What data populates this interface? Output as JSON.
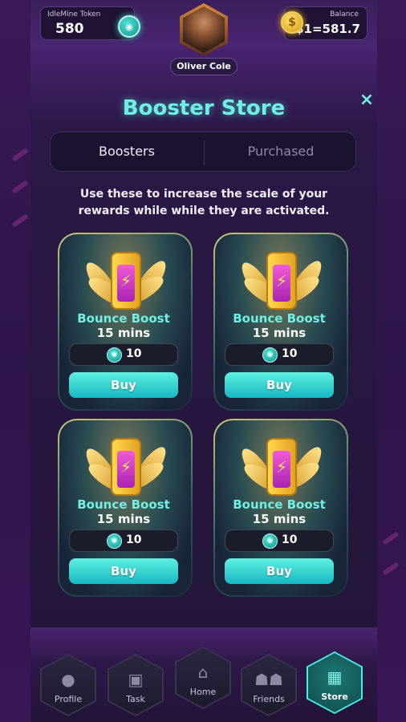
{
  "header": {
    "token_label": "IdleMine Token",
    "token_value": "580",
    "balance_label": "Balance",
    "balance_value": "$1=581.7",
    "balance_coin_symbol": "$",
    "user_name": "Oliver Cole"
  },
  "store": {
    "title": "Booster Store",
    "close_icon": "×",
    "tabs": [
      {
        "label": "Boosters",
        "active": true
      },
      {
        "label": "Purchased",
        "active": false
      }
    ],
    "description": "Use these to increase the scale of your rewards while while they are activated.",
    "cards": [
      {
        "name": "Bounce Boost",
        "duration": "15 mins",
        "price": "10",
        "buy_label": "Buy"
      },
      {
        "name": "Bounce Boost",
        "duration": "15 mins",
        "price": "10",
        "buy_label": "Buy"
      },
      {
        "name": "Bounce Boost",
        "duration": "15 mins",
        "price": "10",
        "buy_label": "Buy"
      },
      {
        "name": "Bounce Boost",
        "duration": "15 mins",
        "price": "10",
        "buy_label": "Buy"
      }
    ]
  },
  "nav": {
    "items": [
      {
        "label": "Profile",
        "icon": "person-icon"
      },
      {
        "label": "Task",
        "icon": "clipboard-icon"
      },
      {
        "label": "Home",
        "icon": "home-icon"
      },
      {
        "label": "Friends",
        "icon": "friends-icon"
      },
      {
        "label": "Store",
        "icon": "store-icon",
        "active": true
      }
    ]
  },
  "colors": {
    "accent": "#6ff0e4",
    "button": "#17b8c2",
    "background": "#2a1440"
  }
}
